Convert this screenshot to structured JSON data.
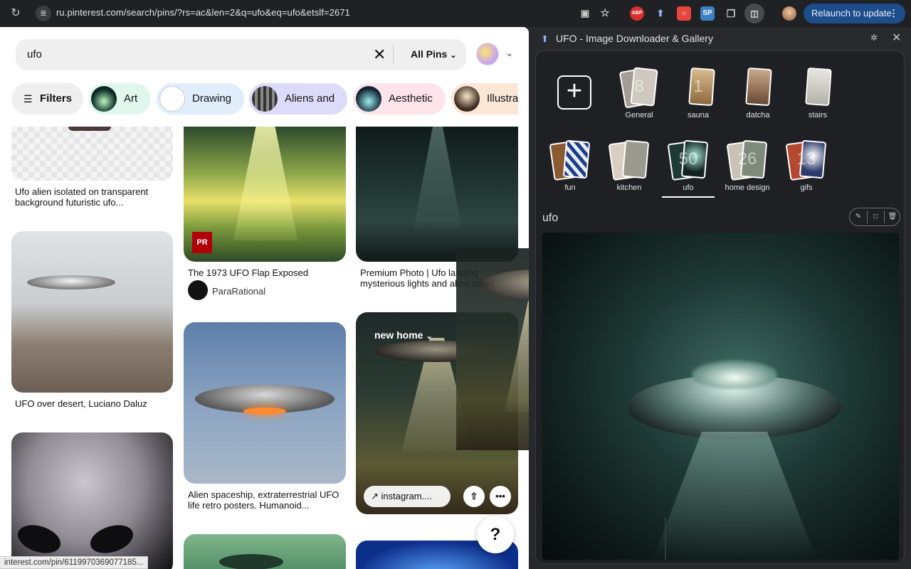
{
  "browser": {
    "url": "ru.pinterest.com/search/pins/?rs=ac&len=2&q=ufo&eq=ufo&etslf=2671",
    "relaunch_label": "Relaunch to update",
    "extensions": [
      "ABP",
      "SP"
    ]
  },
  "pinterest": {
    "search_query": "ufo",
    "scope_label": "All Pins",
    "filters_label": "Filters",
    "chips": [
      "Art",
      "Drawing",
      "Aliens and",
      "Aesthetic",
      "Illustra"
    ],
    "pins": {
      "c1_top_caption": "Ufo alien isolated on transparent background futuristic ufo...",
      "c1_mid_caption": "UFO over desert, Luciano Daluz",
      "c2_top_caption": "The 1973 UFO Flap Exposed",
      "c2_top_badge": "PR",
      "c2_top_author": "ParaRational",
      "c2_mid_caption": "Alien spaceship, extraterrestrial UFO life retro posters. Humanoid...",
      "c3_top_caption": "Premium Photo | Ufo landing mysterious lights and alien cover",
      "c3_mid_board": "new home",
      "c3_mid_link": "instagram...."
    },
    "help_label": "?",
    "status_url": "interest.com/pin/6119970369077185..."
  },
  "sidepanel": {
    "title": "UFO - Image Downloader & Gallery",
    "folders_row1": [
      {
        "name": "General",
        "count": "8"
      },
      {
        "name": "sauna",
        "count": "1"
      },
      {
        "name": "datcha",
        "count": ""
      },
      {
        "name": "stairs",
        "count": ""
      }
    ],
    "folders_row2": [
      {
        "name": "fun",
        "count": ""
      },
      {
        "name": "kitchen",
        "count": ""
      },
      {
        "name": "ufo",
        "count": "50"
      },
      {
        "name": "home design",
        "count": "26"
      },
      {
        "name": "gifs",
        "count": "13"
      }
    ],
    "gallery_title": "ufo"
  }
}
